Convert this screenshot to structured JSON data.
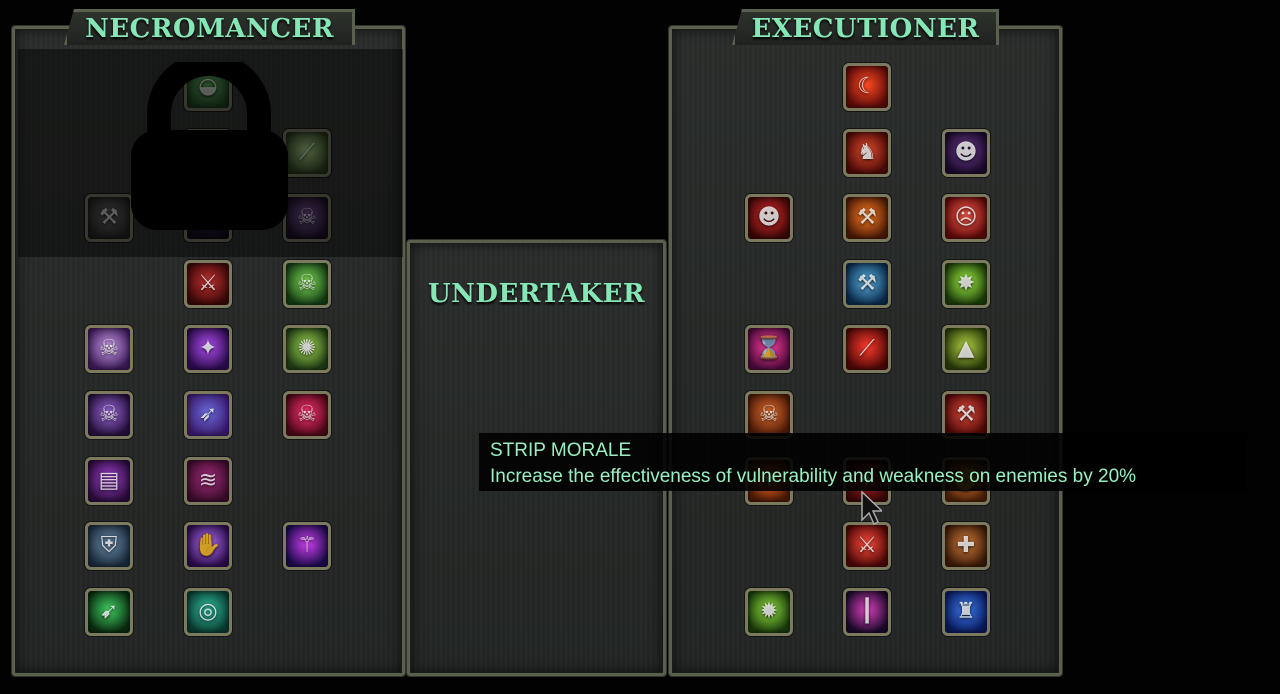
{
  "panels": {
    "necromancer": {
      "title": "NECROMANCER",
      "locked": true
    },
    "undertaker": {
      "title": "UNDERTAKER"
    },
    "executioner": {
      "title": "EXECUTIONER"
    }
  },
  "tooltip": {
    "title": "STRIP MORALE",
    "description": "Increase the effectiveness of vulnerability and weakness on enemies by 20%"
  },
  "necromancer_skills": [
    {
      "name": "slime-skill-icon",
      "glyph": "◒",
      "colors": [
        "#15501e",
        "#48c24f"
      ],
      "dim": true
    },
    {
      "name": "slime-burst-skill-icon",
      "glyph": "◓",
      "colors": [
        "#15501e",
        "#6ad07a"
      ],
      "dim": true
    },
    {
      "name": "green-slash-skill-icon",
      "glyph": "⟋",
      "colors": [
        "#2e4a1a",
        "#a4e070"
      ],
      "dim": true
    },
    {
      "name": "shovel-skill-icon",
      "glyph": "⚒",
      "colors": [
        "#2a2a2a",
        "#6b6b6b"
      ],
      "dim": true
    },
    {
      "name": "shadow-hole-skill-icon",
      "glyph": "●",
      "colors": [
        "#140a22",
        "#3a2056"
      ],
      "dim": true
    },
    {
      "name": "hooded-wraith-skill-icon",
      "glyph": "☠",
      "colors": [
        "#241036",
        "#8b55b8"
      ],
      "dim": true
    },
    {
      "name": "bloody-claws-skill-icon",
      "glyph": "⚔",
      "colors": [
        "#3a0808",
        "#c23030"
      ],
      "dim": false
    },
    {
      "name": "poison-skull-skill-icon",
      "glyph": "☠",
      "colors": [
        "#143a14",
        "#7edc55"
      ],
      "dim": false
    },
    {
      "name": "purple-skeleton-skill-icon",
      "glyph": "☠",
      "colors": [
        "#3b1a55",
        "#c79ae8"
      ],
      "dim": false
    },
    {
      "name": "arcane-orb-skill-icon",
      "glyph": "✦",
      "colors": [
        "#2a0c4a",
        "#b04cf2"
      ],
      "dim": false
    },
    {
      "name": "green-spirit-skill-icon",
      "glyph": "✺",
      "colors": [
        "#1f3a14",
        "#9ed850"
      ],
      "dim": false
    },
    {
      "name": "skull-sigil-skill-icon",
      "glyph": "☠",
      "colors": [
        "#24103a",
        "#9a66d8"
      ],
      "dim": false
    },
    {
      "name": "spear-throw-skill-icon",
      "glyph": "➶",
      "colors": [
        "#3a1a6a",
        "#6a6ae0"
      ],
      "dim": false
    },
    {
      "name": "crimson-skull-skill-icon",
      "glyph": "☠",
      "colors": [
        "#4a0818",
        "#ff3070"
      ],
      "dim": false
    },
    {
      "name": "shadow-cards-skill-icon",
      "glyph": "▤",
      "colors": [
        "#2a0c3a",
        "#a040d0"
      ],
      "dim": false
    },
    {
      "name": "dark-claw-skill-icon",
      "glyph": "≋",
      "colors": [
        "#3a0c2a",
        "#a02a7a"
      ],
      "dim": false
    },
    {
      "name": "dark-knight-skill-icon",
      "glyph": "⛨",
      "colors": [
        "#1a2a3a",
        "#6a8aaa"
      ],
      "dim": false
    },
    {
      "name": "summon-hands-skill-icon",
      "glyph": "✋",
      "colors": [
        "#2a0c4a",
        "#b070f0"
      ],
      "dim": false
    },
    {
      "name": "magic-staff-skill-icon",
      "glyph": "⚚",
      "colors": [
        "#1a0a4a",
        "#d040f0"
      ],
      "dim": false
    },
    {
      "name": "green-arrow-skill-icon",
      "glyph": "➹",
      "colors": [
        "#0a2a10",
        "#40d060"
      ],
      "dim": false
    },
    {
      "name": "rune-circle-skill-icon",
      "glyph": "◎",
      "colors": [
        "#0a3a30",
        "#30c0a0"
      ],
      "dim": false
    }
  ],
  "executioner_skills": [
    {
      "name": "blood-scythe-skill-icon",
      "glyph": "☾",
      "colors": [
        "#5a0a0a",
        "#ff4a20"
      ]
    },
    {
      "name": "demon-helm-skill-icon",
      "glyph": "♞",
      "colors": [
        "#4a0a08",
        "#e04a2a"
      ]
    },
    {
      "name": "shadow-beast-skill-icon",
      "glyph": "☻",
      "colors": [
        "#1a0a2a",
        "#6a3a8a"
      ]
    },
    {
      "name": "demon-face-skill-icon",
      "glyph": "☻",
      "colors": [
        "#3a0808",
        "#e02a2a"
      ]
    },
    {
      "name": "fire-hammer-skill-icon",
      "glyph": "⚒",
      "colors": [
        "#4a1a08",
        "#ff7a20"
      ]
    },
    {
      "name": "rage-face-skill-icon",
      "glyph": "☹",
      "colors": [
        "#5a0a0a",
        "#ff5a4a"
      ]
    },
    {
      "name": "ice-axe-skill-icon",
      "glyph": "⚒",
      "colors": [
        "#0a2a4a",
        "#5ab0e0"
      ]
    },
    {
      "name": "venom-burst-skill-icon",
      "glyph": "✸",
      "colors": [
        "#1a3a0a",
        "#a0f040"
      ]
    },
    {
      "name": "hourglass-skill-icon",
      "glyph": "⌛",
      "colors": [
        "#4a0a3a",
        "#ff40a0"
      ]
    },
    {
      "name": "blood-slash-skill-icon",
      "glyph": "⟋",
      "colors": [
        "#4a0808",
        "#ff3a2a"
      ]
    },
    {
      "name": "green-shards-skill-icon",
      "glyph": "▲",
      "colors": [
        "#2a3a0a",
        "#b0d040"
      ]
    },
    {
      "name": "burning-skull-skill-icon",
      "glyph": "☠",
      "colors": [
        "#4a1a08",
        "#e06a2a"
      ]
    },
    {
      "name": "war-hammer-skill-icon",
      "glyph": "⚒",
      "colors": [
        "#4a0808",
        "#e04a3a"
      ]
    },
    {
      "name": "flame-strike-skill-icon",
      "glyph": "✶",
      "colors": [
        "#4a1a08",
        "#ff6a20"
      ]
    },
    {
      "name": "strip-morale-skill-icon",
      "glyph": "✦",
      "colors": [
        "#3a0808",
        "#b02020"
      ]
    },
    {
      "name": "fire-fist-skill-icon",
      "glyph": "✊",
      "colors": [
        "#4a2008",
        "#e07a30"
      ]
    },
    {
      "name": "blade-cut-skill-icon",
      "glyph": "⚔",
      "colors": [
        "#4a0808",
        "#ff4a3a"
      ]
    },
    {
      "name": "heal-cross-skill-icon",
      "glyph": "✚",
      "colors": [
        "#3a1a08",
        "#d07a3a"
      ]
    },
    {
      "name": "spiked-mace-skill-icon",
      "glyph": "✹",
      "colors": [
        "#1a3a0a",
        "#90e040"
      ]
    },
    {
      "name": "void-beam-skill-icon",
      "glyph": "┃",
      "colors": [
        "#1a0a2a",
        "#e040c0"
      ]
    },
    {
      "name": "blue-warrior-skill-icon",
      "glyph": "♜",
      "colors": [
        "#0a1a5a",
        "#3a7af0"
      ]
    }
  ]
}
